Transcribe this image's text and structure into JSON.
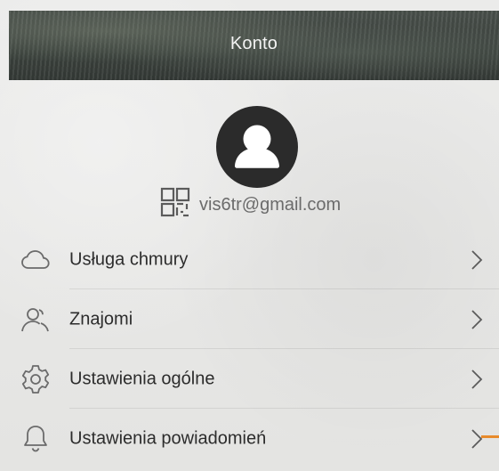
{
  "header": {
    "title": "Konto"
  },
  "profile": {
    "email": "vis6tr@gmail.com",
    "avatar_icon": "user-avatar-icon",
    "qr_icon": "qr-code-icon"
  },
  "menu": {
    "items": [
      {
        "label": "Usługa chmury",
        "icon": "cloud-icon"
      },
      {
        "label": "Znajomi",
        "icon": "friends-icon"
      },
      {
        "label": "Ustawienia ogólne",
        "icon": "gear-icon"
      },
      {
        "label": "Ustawienia powiadomień",
        "icon": "bell-icon"
      }
    ],
    "chevron_icon": "chevron-right-icon"
  },
  "colors": {
    "header_bg": "#3f4641",
    "accent": "#e88a2b",
    "text": "#2c2c2c",
    "secondary_text": "#6b6b6b",
    "avatar_bg": "#2b2b2b"
  }
}
